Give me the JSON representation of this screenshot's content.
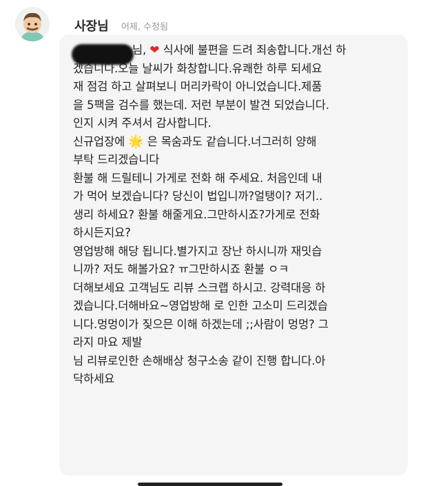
{
  "comment": {
    "author": "사장님",
    "meta": "어제, 수정됨",
    "avatar_icon": "character-avatar-icon",
    "heart_icon": "❤",
    "sparkle_icon": "🌟",
    "lines": {
      "l1": "님, ",
      "l1b": " 식사에 불편을 드려 죄송합니다.개선 하",
      "l2": "겠습니다.오늘 날씨가 화창합니다.유쾌한 하루 되세요",
      "l3": "재 점검 하고 살펴보니 머리카락이 아니었습니다.제품",
      "l4": "을 5팩을 검수를 했는데. 저런 부분이 발견 되었습니다.",
      "l5": "인지 시켜 주셔서 감사합니다.",
      "l6a": "신규업장에 ",
      "l6b": " 은 목숨과도 같습니다.너그러히 양해",
      "l7": "부탁 드리겠습니다",
      "l8": "환불 해 드릴테니 가게로 전화 해 주세요. 처음인데 내",
      "l9": "가 먹어 보겠습니다?  당신이 법입니까?얼탱이? 저기..",
      "l10": "생리 하세요? 환불 해줄게요.그만하시죠?가게로 전화",
      "l11": "하시든지요?",
      "l12": "영업방해 해당 됩니다.별가지고 장난 하시니까 재밋습",
      "l13": "니까? 저도 해볼가요? ㅠ그만하시죠 환불 ㅇㅋ",
      "l14": "더해보세요 고객님도 리뷰 스크랩 하시고. 강력대응 하",
      "l15": "겠습니다.더해바요~영업방해 로 인한 고소미 드리겠습",
      "l16": "니다.멍멍이가 짖으믄 이해 하겠는데 ;;사람이 멍멍? 그",
      "l17": "라지 마요 제발",
      "l18": "님 리뷰로인한 손해배상 청구소송 같이 진행 합니다.아",
      "l19": "닥하세요"
    }
  }
}
